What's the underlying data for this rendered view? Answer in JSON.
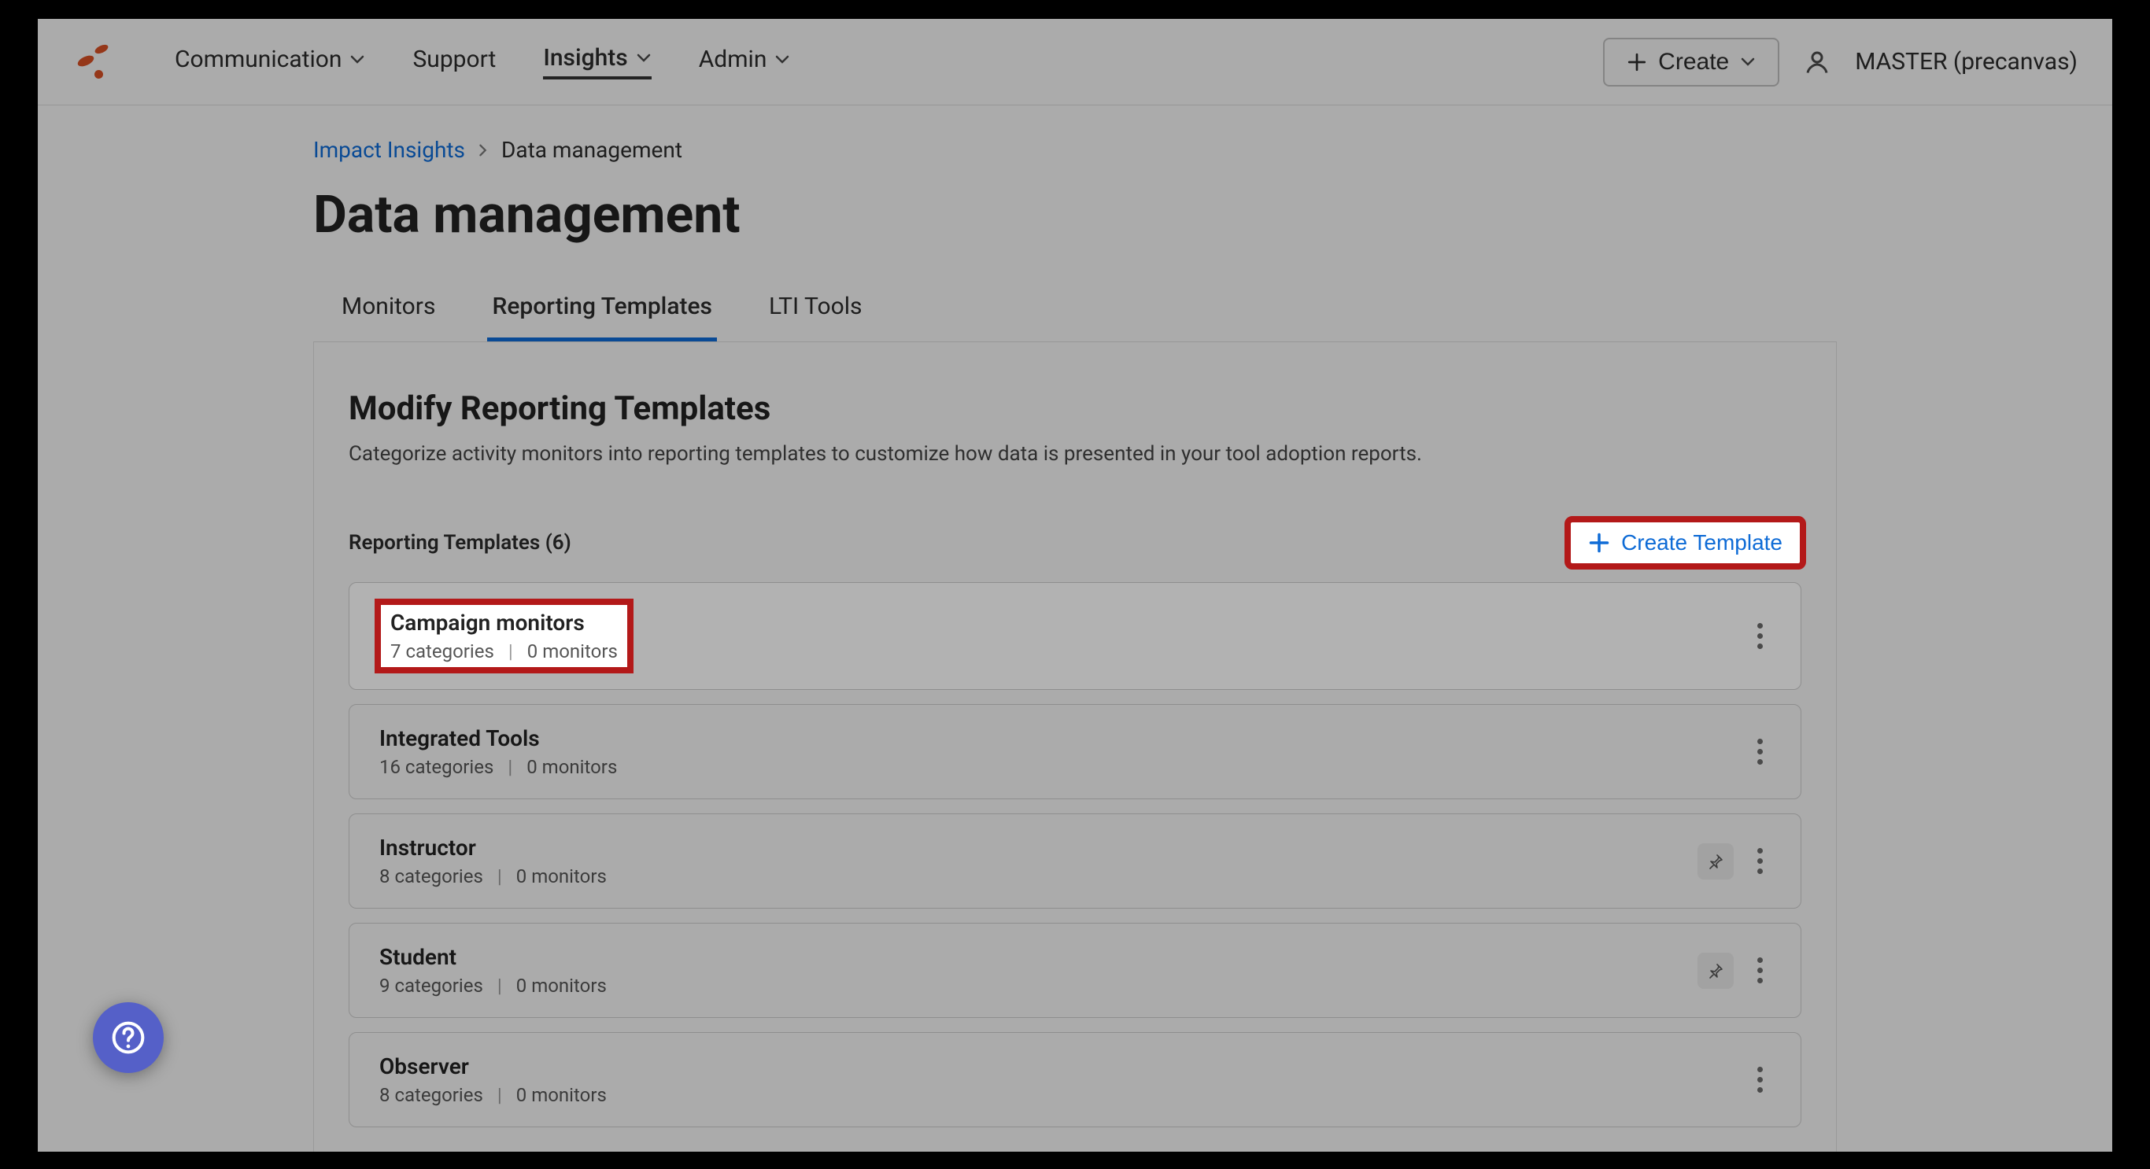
{
  "nav": {
    "communication": "Communication",
    "support": "Support",
    "insights": "Insights",
    "admin": "Admin",
    "create": "Create",
    "tenant": "MASTER (precanvas)"
  },
  "breadcrumb": {
    "root": "Impact Insights",
    "current": "Data management"
  },
  "page": {
    "title": "Data management"
  },
  "tabs": {
    "monitors": "Monitors",
    "reporting": "Reporting Templates",
    "lti": "LTI Tools"
  },
  "panel": {
    "title": "Modify Reporting Templates",
    "desc": "Categorize activity monitors into reporting templates to customize how data is presented in your tool adoption reports."
  },
  "listHeader": {
    "label": "Reporting Templates (6)",
    "createLabel": "Create Template"
  },
  "templates": [
    {
      "title": "Campaign monitors",
      "categories": "7 categories",
      "monitors": "0 monitors",
      "pinned": false
    },
    {
      "title": "Integrated Tools",
      "categories": "16 categories",
      "monitors": "0 monitors",
      "pinned": false
    },
    {
      "title": "Instructor",
      "categories": "8 categories",
      "monitors": "0 monitors",
      "pinned": true
    },
    {
      "title": "Student",
      "categories": "9 categories",
      "monitors": "0 monitors",
      "pinned": true
    },
    {
      "title": "Observer",
      "categories": "8 categories",
      "monitors": "0 monitors",
      "pinned": false
    }
  ]
}
